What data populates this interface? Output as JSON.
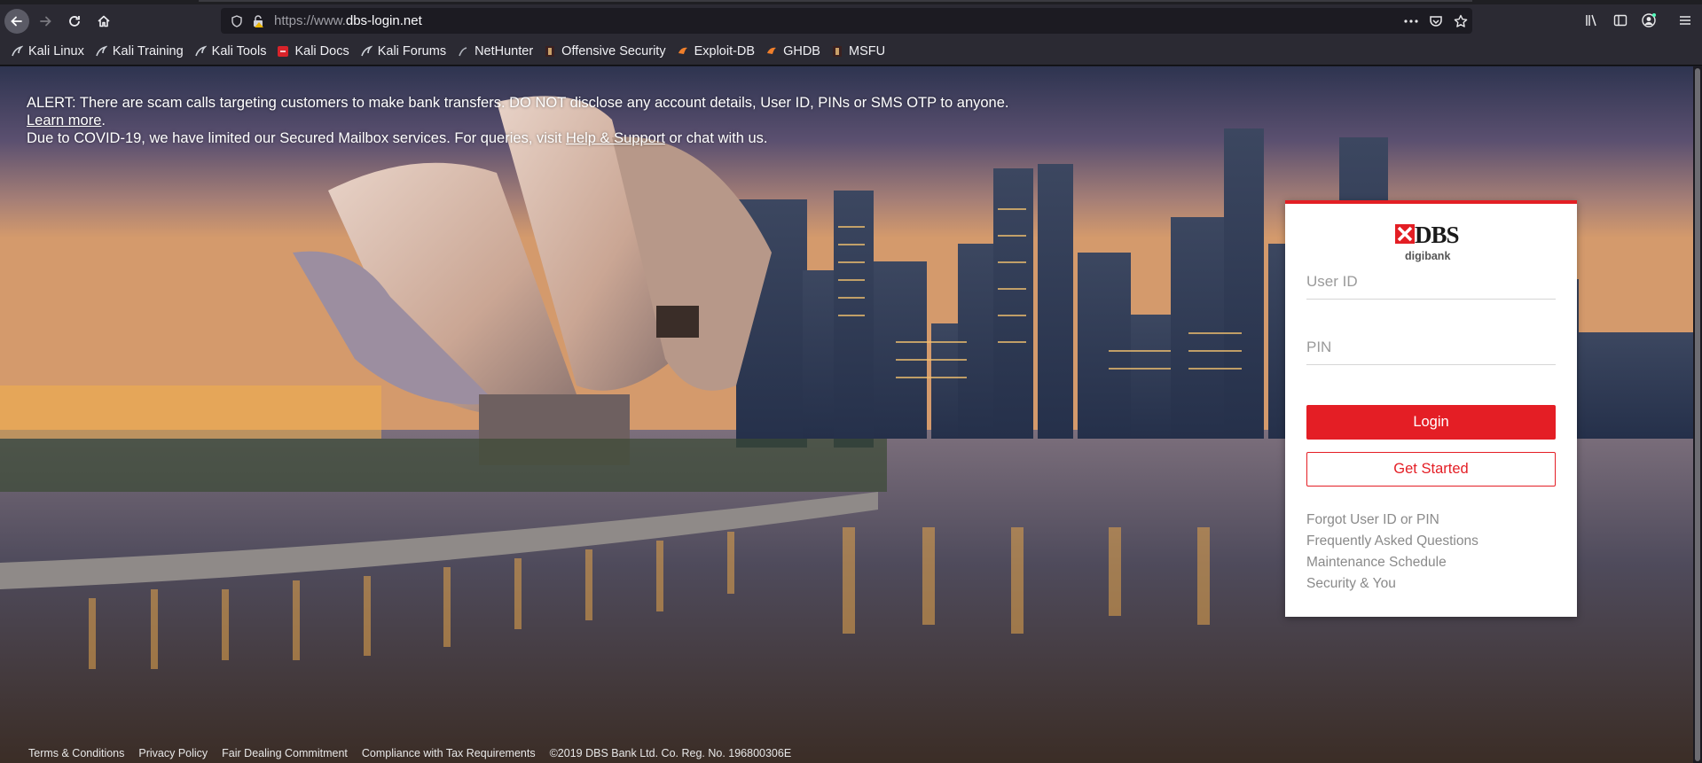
{
  "browser": {
    "url_prefix": "https://www.",
    "url_host": "dbs-login.net",
    "bookmarks": [
      {
        "label": "Kali Linux",
        "icon": "kali-dragon-icon"
      },
      {
        "label": "Kali Training",
        "icon": "kali-dragon-icon"
      },
      {
        "label": "Kali Tools",
        "icon": "kali-dragon-icon"
      },
      {
        "label": "Kali Docs",
        "icon": "kali-docs-icon"
      },
      {
        "label": "Kali Forums",
        "icon": "kali-dragon-icon"
      },
      {
        "label": "NetHunter",
        "icon": "nethunter-icon"
      },
      {
        "label": "Offensive Security",
        "icon": "offsec-icon"
      },
      {
        "label": "Exploit-DB",
        "icon": "exploitdb-icon"
      },
      {
        "label": "GHDB",
        "icon": "exploitdb-icon"
      },
      {
        "label": "MSFU",
        "icon": "offsec-icon"
      }
    ]
  },
  "alert": {
    "line1_text": "ALERT: There are scam calls targeting customers to make bank transfers. DO NOT disclose any account details, User ID, PINs or SMS OTP to anyone.",
    "learn_more": "Learn more",
    "line1_end": ".",
    "line2_start": "Due to COVID-19, we have limited our Secured Mailbox services. For queries, visit",
    "help_link": "Help & Support",
    "line2_end": "or chat with us."
  },
  "login": {
    "brand": "DBS",
    "sub_brand": "digibank",
    "user_id_placeholder": "User ID",
    "pin_placeholder": "PIN",
    "login_button": "Login",
    "get_started_button": "Get Started",
    "links": [
      "Forgot User ID or PIN",
      "Frequently Asked Questions",
      "Maintenance Schedule",
      "Security & You"
    ]
  },
  "footer": {
    "items": [
      "Terms & Conditions",
      "Privacy Policy",
      "Fair Dealing Commitment",
      "Compliance with Tax Requirements",
      "©2019 DBS Bank Ltd. Co. Reg. No. 196800306E"
    ]
  },
  "colors": {
    "brand_red": "#e31e24",
    "chrome_bg": "#2b2a33"
  }
}
